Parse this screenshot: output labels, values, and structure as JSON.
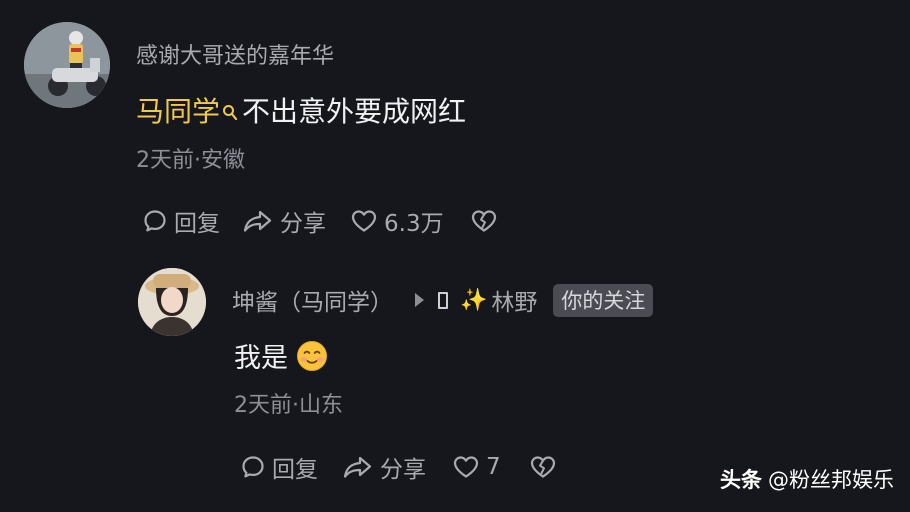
{
  "comment": {
    "username": "感谢大哥送的嘉年华",
    "mention": "马同学",
    "text": "不出意外要成网红",
    "meta": "2天前·安徽",
    "actions": {
      "reply_label": "回复",
      "share_label": "分享",
      "like_count": "6.3万"
    }
  },
  "reply": {
    "username": "坤酱（马同学）",
    "target_name": "林野",
    "badge": "你的关注",
    "text": "我是",
    "meta": "2天前·山东",
    "actions": {
      "reply_label": "回复",
      "share_label": "分享",
      "like_count": "7"
    }
  },
  "watermark": {
    "brand": "头条",
    "account": "@粉丝邦娱乐"
  },
  "icons": {
    "reply": "comment-bubble-icon",
    "share": "share-arrow-icon",
    "like": "heart-icon",
    "dislike": "broken-heart-icon",
    "search": "search-icon",
    "sparkle": "sparkle-icon",
    "emoji": "smiling-face-emoji"
  },
  "colors": {
    "background": "#16171d",
    "mention": "#f2c94c",
    "secondary_text": "#a9aab0",
    "badge_bg": "#4a4b53"
  }
}
